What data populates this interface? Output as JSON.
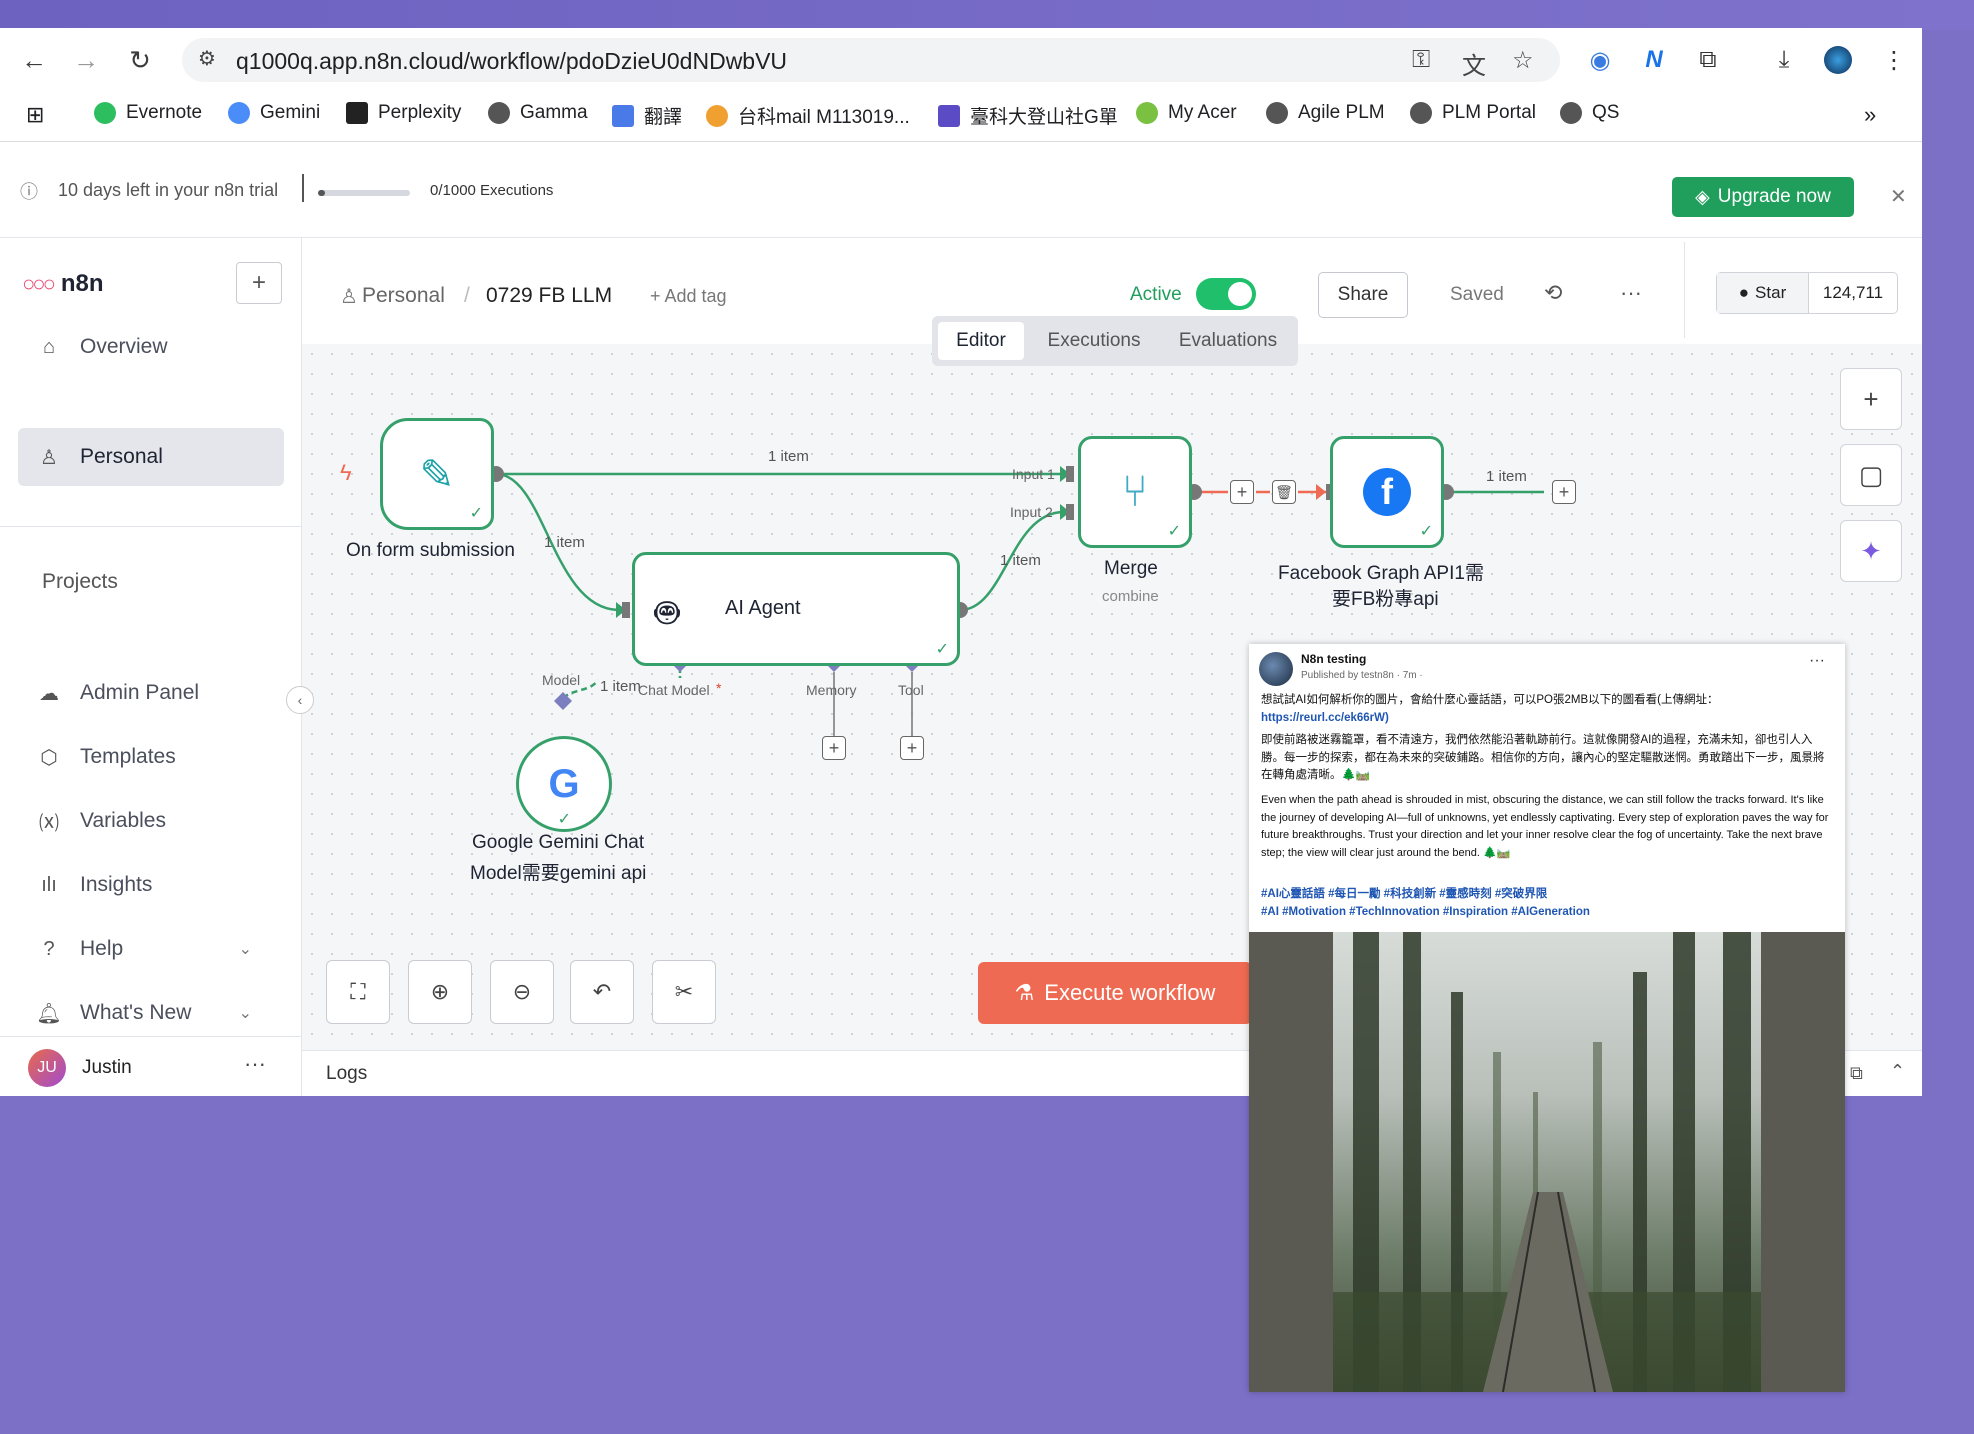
{
  "browser": {
    "url": "q1000q.app.n8n.cloud/workflow/pdoDzieU0dNDwbVU",
    "bookmarks": [
      "Evernote",
      "Gemini",
      "Perplexity",
      "Gamma",
      "翻譯",
      "台科mail M113019...",
      "臺科大登山社G單",
      "My Acer",
      "Agile PLM",
      "PLM Portal",
      "QS"
    ],
    "bookmark_colors": [
      "#2dbe60",
      "#4b8df8",
      "#222222",
      "#555555",
      "#4a7ae8",
      "#f0a030",
      "#5b4bc4",
      "#7ac142",
      "#555555",
      "#555555",
      "#555555"
    ],
    "more_label": "»"
  },
  "trial": {
    "text": "10 days left in your n8n trial",
    "progress": 0.0,
    "executions": "0/1000 Executions",
    "upgrade_label": "Upgrade now"
  },
  "sidebar": {
    "brand": "n8n",
    "overview": "Overview",
    "personal": "Personal",
    "projects": "Projects",
    "items": [
      "Admin Panel",
      "Templates",
      "Variables",
      "Insights",
      "Help",
      "What's New"
    ],
    "user_initials": "JU",
    "user_name": "Justin"
  },
  "header": {
    "project": "Personal",
    "workflow_name": "0729 FB LLM",
    "add_tag": "+ Add tag",
    "active_label": "Active",
    "share_label": "Share",
    "saved_label": "Saved",
    "github_star": "Star",
    "github_count": "124,711"
  },
  "tabs": [
    "Editor",
    "Executions",
    "Evaluations"
  ],
  "workflow": {
    "trigger_label": "On form submission",
    "agent_label": "AI Agent",
    "merge_label": "Merge",
    "merge_sub": "combine",
    "fb_label_1": "Facebook Graph API1需",
    "fb_label_2": "要FB粉專api",
    "gemini_label_1": "Google Gemini Chat",
    "gemini_label_2": "Model需要gemini api",
    "edge_1": "1 item",
    "edge_2": "1 item",
    "edge_3": "1 item",
    "edge_4": "1 item",
    "edge_5": "1 item",
    "input_1": "Input 1",
    "input_2": "Input 2",
    "port_model": "Model",
    "port_chat_model": "Chat Model",
    "port_memory": "Memory",
    "port_tool": "Tool"
  },
  "execute_label": "Execute workflow",
  "logs_label": "Logs",
  "fb_post": {
    "page_name": "N8n testing",
    "meta": "Published by testn8n · 7m ·",
    "line1": "想試試AI如何解析你的圖片，會給什麼心靈話語，可以PO張2MB以下的圖看看(上傳網址：",
    "link": "https://reurl.cc/ek66rW)",
    "zh_paragraph": "即使前路被迷霧籠罩，看不清遠方，我們依然能沿著軌跡前行。這就像開發AI的過程，充滿未知，卻也引人入勝。每一步的探索，都在為未來的突破鋪路。相信你的方向，讓內心的堅定驅散迷惘。勇敢踏出下一步，風景將在轉角處清晰。🌲🛤️",
    "en_paragraph": "Even when the path ahead is shrouded in mist, obscuring the distance, we can still follow the tracks forward. It's like the journey of developing AI—full of unknowns, yet endlessly captivating. Every step of exploration paves the way for future breakthroughs. Trust your direction and let your inner resolve clear the fog of uncertainty. Take the next brave step; the view will clear just around the bend. 🌲🛤️",
    "tags_zh": "#AI心靈話語 #每日一勵 #科技創新 #靈感時刻 #突破界限",
    "tags_en": "#AI #Motivation #TechInnovation #Inspiration #AIGeneration"
  }
}
